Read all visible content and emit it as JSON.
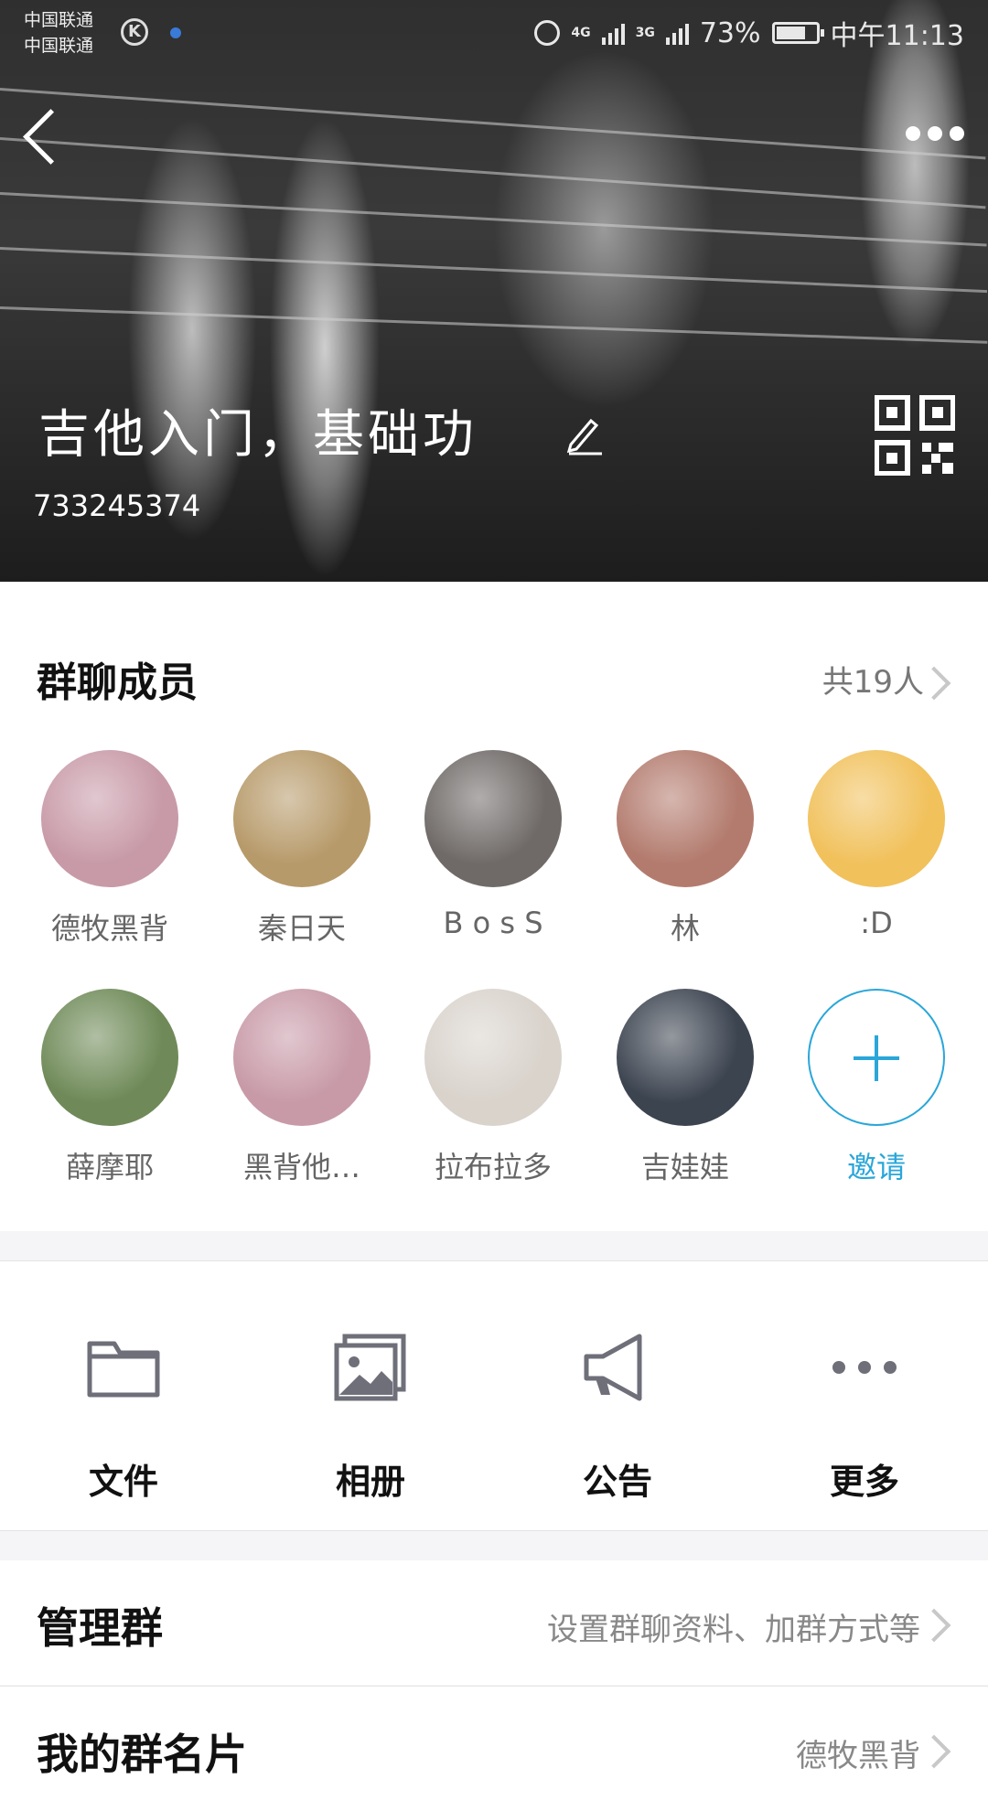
{
  "statusbar": {
    "carrier1": "中国联通",
    "carrier2": "中国联通",
    "carrier_icon": "K",
    "net1": "4G",
    "net2": "3G",
    "battery": "73%",
    "battery_level": 0.73,
    "time": "中午11:13"
  },
  "header": {
    "group_name": "吉他入门，基础功",
    "group_id": "733245374"
  },
  "members": {
    "title": "群聊成员",
    "count_label": "共19人",
    "list": [
      {
        "name": "德牧黑背",
        "avatar": "#c89aa8"
      },
      {
        "name": "秦日天",
        "avatar": "#b79a6a"
      },
      {
        "name": "B o s S",
        "avatar": "#6f6a68"
      },
      {
        "name": "林",
        "avatar": "#b37b6e"
      },
      {
        "name": ":D",
        "avatar": "#f1c15c"
      },
      {
        "name": "薛摩耶",
        "avatar": "#6f8a58"
      },
      {
        "name": "黑背他…",
        "avatar": "#c89aa8"
      },
      {
        "name": "拉布拉多",
        "avatar": "#d9d3cc"
      },
      {
        "name": "吉娃娃",
        "avatar": "#3c4450"
      }
    ],
    "invite_label": "邀请"
  },
  "tools": [
    {
      "label": "文件",
      "icon": "folder-icon"
    },
    {
      "label": "相册",
      "icon": "album-icon"
    },
    {
      "label": "公告",
      "icon": "megaphone-icon"
    },
    {
      "label": "更多",
      "icon": "more-dots-icon"
    }
  ],
  "rows": {
    "manage_title": "管理群",
    "manage_value": "设置群聊资料、加群方式等",
    "card_title": "我的群名片",
    "card_value": "德牧黑背"
  },
  "colors": {
    "accent": "#2aa6d9",
    "icon_gray": "#6e6f79"
  }
}
